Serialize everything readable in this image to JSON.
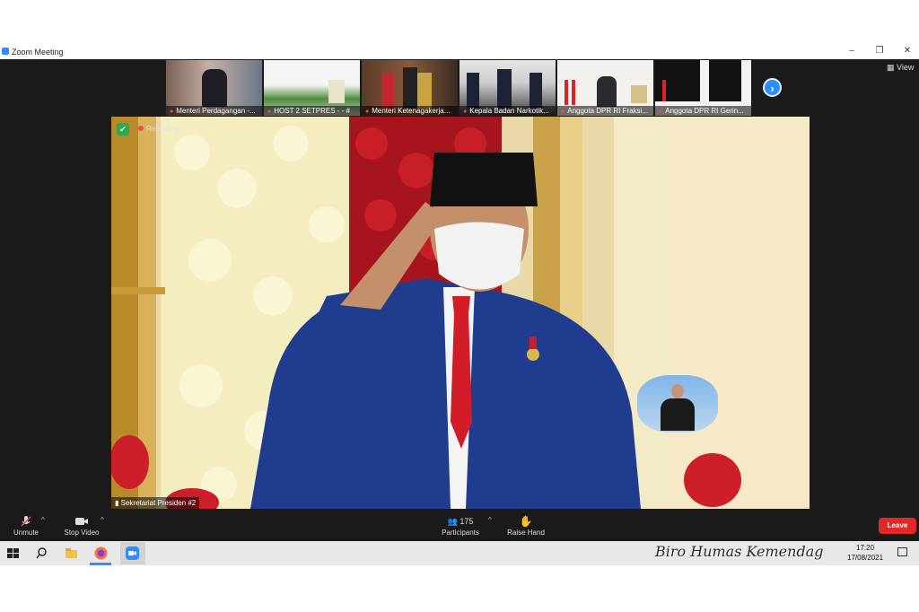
{
  "window": {
    "title": "Zoom Meeting"
  },
  "thumbnails": [
    {
      "name": "Menteri Perdagangan -..."
    },
    {
      "name": "HOST 2 SETPRES - - #"
    },
    {
      "name": "Menteri Ketenagakerja..."
    },
    {
      "name": "Kepala Badan Narkotik..."
    },
    {
      "name": "Anggota DPR RI Fraksi..."
    },
    {
      "name": "Anggota DPR RI Gerin..."
    }
  ],
  "view_label": "View",
  "main_video": {
    "recording_label": "Recording",
    "speaker_name": "Sekretariat Presiden #2"
  },
  "toolbar": {
    "unmute": "Unmute",
    "stop_video": "Stop Video",
    "participants_label": "Participants",
    "participants_count": "175",
    "raise_hand": "Raise Hand",
    "leave": "Leave"
  },
  "taskbar": {
    "time": "17:20",
    "date": "17/08/2021"
  },
  "watermark": "Biro Humas Kemendag",
  "colors": {
    "zoom_blue": "#2d8cff",
    "leave_red": "#e02828",
    "recording_red": "#e8524a"
  }
}
